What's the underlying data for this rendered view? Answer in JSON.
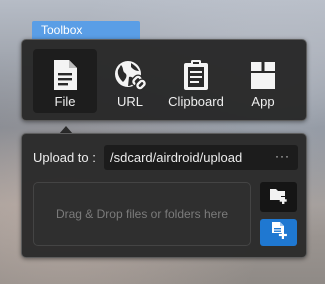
{
  "toolbox": {
    "title": "Toolbox"
  },
  "apps": [
    {
      "label": "File",
      "icon": "file-icon",
      "active": true
    },
    {
      "label": "URL",
      "icon": "globe-link-icon",
      "active": false
    },
    {
      "label": "Clipboard",
      "icon": "clipboard-icon",
      "active": false
    },
    {
      "label": "App",
      "icon": "app-box-icon",
      "active": false
    }
  ],
  "upload": {
    "label": "Upload to :",
    "path": "/sdcard/airdroid/upload",
    "more": "···",
    "drop_text": "Drag & Drop files or folders here",
    "folder_button_icon": "add-folder-icon",
    "file_button_icon": "add-file-icon"
  },
  "colors": {
    "tab_blue": "#5a9ee6",
    "panel_bg": "#282828",
    "accent_blue": "#1f78d1"
  }
}
